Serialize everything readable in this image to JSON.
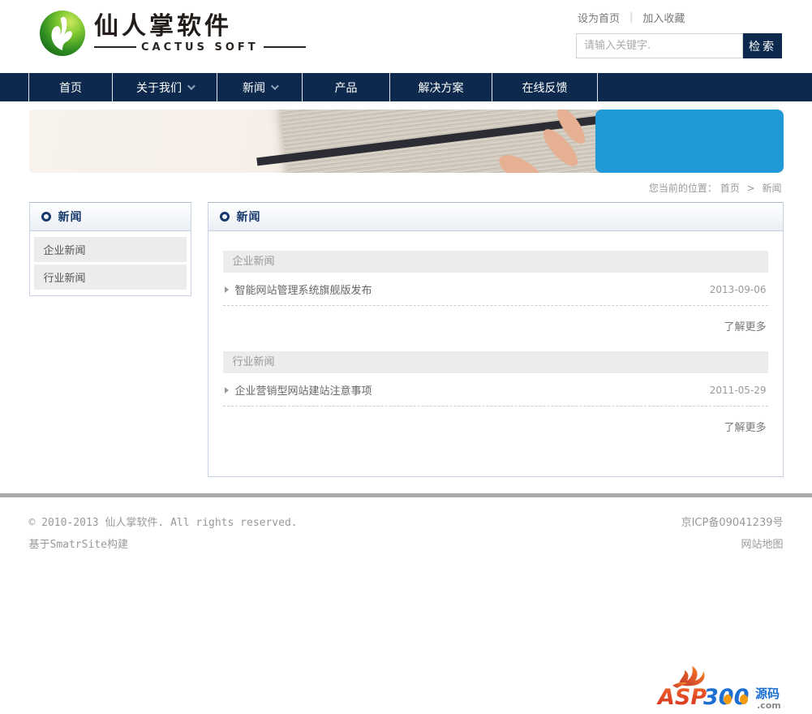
{
  "header": {
    "logo": {
      "title": "仙人掌软件",
      "subtitle": "CACTUS SOFT"
    },
    "top_links": {
      "set_home": "设为首页",
      "add_favorite": "加入收藏"
    },
    "search": {
      "placeholder": "请输入关键字.",
      "button_label": "检索"
    }
  },
  "nav": {
    "items": [
      {
        "label": "首页"
      },
      {
        "label": "关于我们"
      },
      {
        "label": "新闻"
      },
      {
        "label": "产品"
      },
      {
        "label": "解决方案"
      },
      {
        "label": "在线反馈"
      }
    ]
  },
  "breadcrumb": {
    "prefix": "您当前的位置：",
    "home": "首页",
    "separator": ">",
    "current": "新闻"
  },
  "sidebar": {
    "title": "新闻",
    "items": [
      {
        "label": "企业新闻"
      },
      {
        "label": "行业新闻"
      }
    ]
  },
  "main": {
    "title": "新闻",
    "sections": [
      {
        "heading": "企业新闻",
        "items": [
          {
            "title": "智能网站管理系统旗舰版发布",
            "date": "2013-09-06"
          }
        ],
        "more_label": "了解更多"
      },
      {
        "heading": "行业新闻",
        "items": [
          {
            "title": "企业营销型网站建站注意事项",
            "date": "2011-05-29"
          }
        ],
        "more_label": "了解更多"
      }
    ]
  },
  "footer": {
    "copyright": "© 2010-2013 仙人掌软件. All rights reserved.",
    "built_with": "基于SmatrSite构建",
    "icp": "京ICP备09041239号",
    "sitemap": "网站地图"
  },
  "watermark": {
    "asp": "ASP",
    "num": "300",
    "cn": "源码",
    "com": ".com"
  },
  "colors": {
    "navy": "#0d2a4e",
    "banner_blue": "#1f9ad6",
    "title_navy": "#17386b"
  }
}
